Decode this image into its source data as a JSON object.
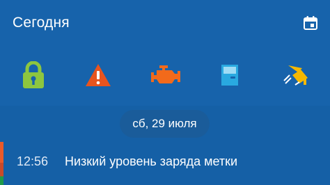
{
  "header": {
    "title": "Сегодня"
  },
  "status_icons": [
    {
      "icon": "padlock-locked-icon",
      "color": "#8dc63f"
    },
    {
      "icon": "warning-triangle-icon",
      "color": "#e8541e"
    },
    {
      "icon": "engine-icon",
      "color": "#f26a1b"
    },
    {
      "icon": "car-door-icon",
      "color": "#29a9e0"
    },
    {
      "icon": "trunk-hatch-icon",
      "color": "#f5b800"
    }
  ],
  "feed": {
    "date_label": "сб, 29 июля",
    "events": [
      {
        "time": "12:56",
        "text": "Низкий уровень заряда метки"
      }
    ]
  }
}
